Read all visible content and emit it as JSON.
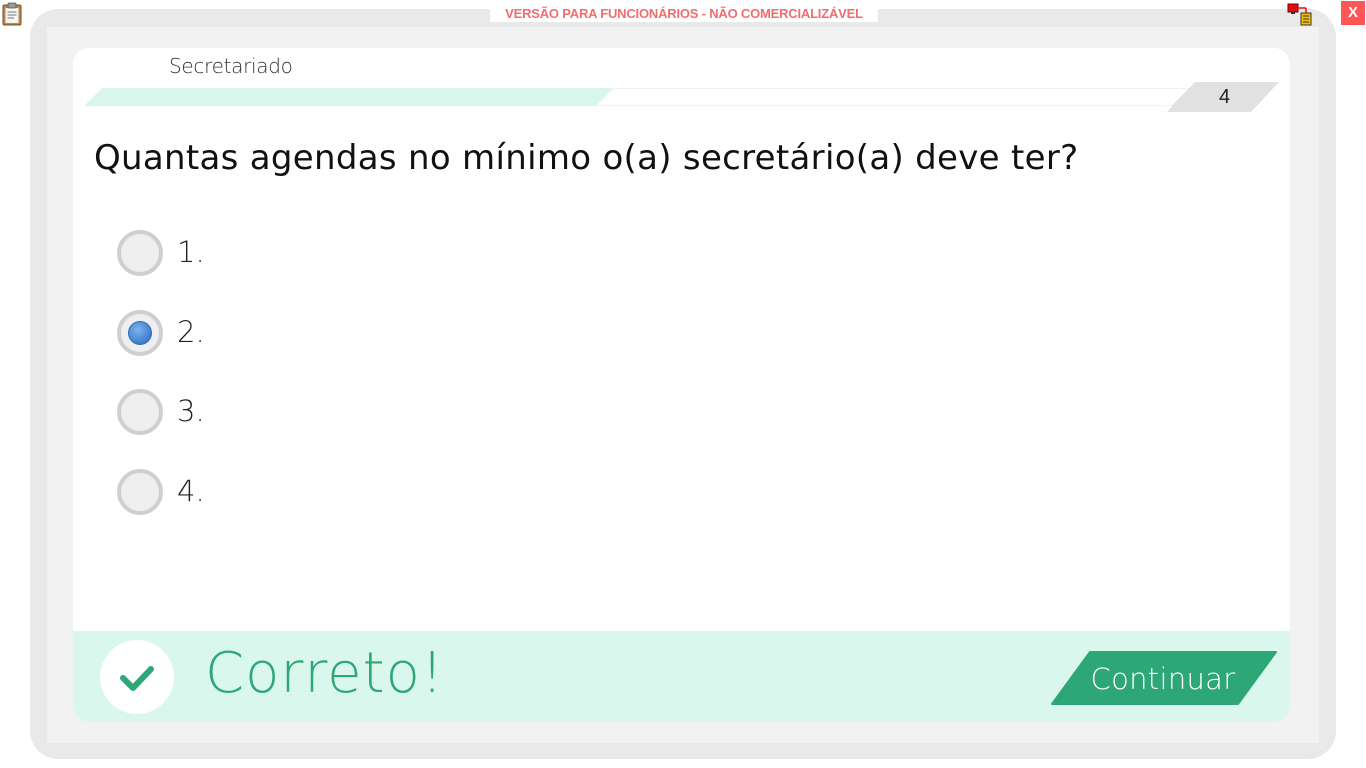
{
  "watermark": "VERSÃO PARA FUNCIONÁRIOS - NÃO COMERCIALIZÁVEL",
  "window": {
    "close_label": "X"
  },
  "quiz": {
    "subject": "Secretariado",
    "question_number": "4",
    "progress_fraction": 0.47,
    "question": "Quantas agendas no mínimo o(a) secretário(a) deve ter?",
    "options": [
      {
        "label": "1.",
        "selected": false
      },
      {
        "label": "2.",
        "selected": true
      },
      {
        "label": "3.",
        "selected": false
      },
      {
        "label": "4.",
        "selected": false
      }
    ]
  },
  "feedback": {
    "text": "Correto!",
    "continue_label": "Continuar"
  },
  "colors": {
    "accent_green": "#2ea776",
    "feedback_background": "#d9f7ec",
    "selected_radio": "#3d7fce",
    "watermark_red": "#f26d6d"
  },
  "icons": {
    "top_left": "clipboard-icon",
    "top_right": "network-monitor-icon",
    "feedback": "checkmark-icon"
  }
}
